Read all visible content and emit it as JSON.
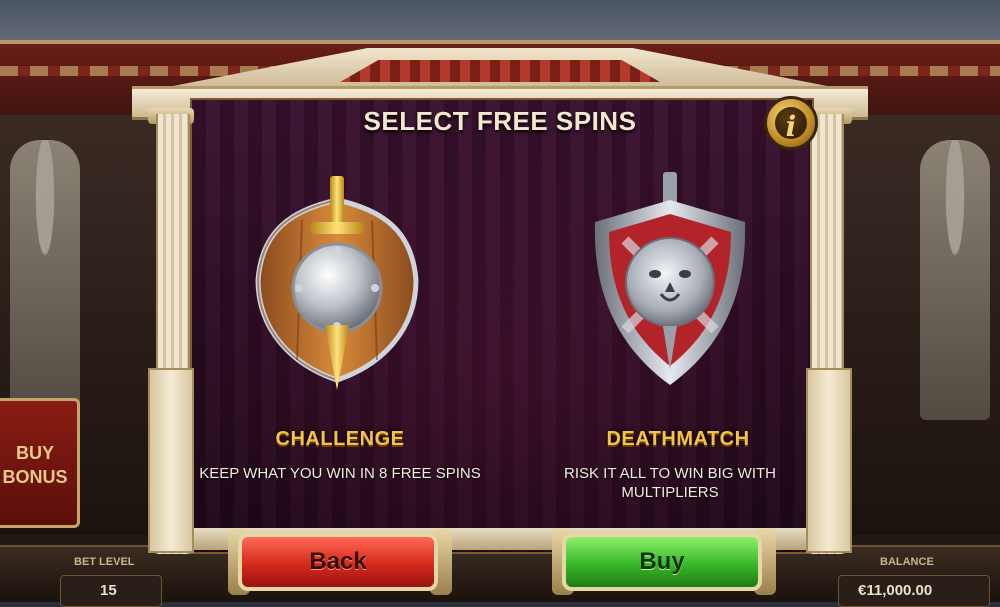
{
  "dialog": {
    "title": "SELECT FREE SPINS",
    "info_label": "i"
  },
  "options": [
    {
      "name": "CHALLENGE",
      "description": "KEEP WHAT YOU WIN IN 8 FREE SPINS"
    },
    {
      "name": "DEATHMATCH",
      "description": "RISK IT ALL TO WIN BIG WITH MULTIPLIERS"
    }
  ],
  "buttons": {
    "back": "Back",
    "buy": "Buy"
  },
  "background": {
    "buy_bonus": "BUY BONUS",
    "hud": {
      "bet_level_label": "BET LEVEL",
      "bet_level_value": "15",
      "balance_label": "BALANCE",
      "balance_value": "€11,000.00"
    }
  },
  "colors": {
    "title": "#f3e7cf",
    "option_name": "#f2c44a",
    "back_button": "#d42a1c",
    "buy_button": "#38b82a"
  }
}
